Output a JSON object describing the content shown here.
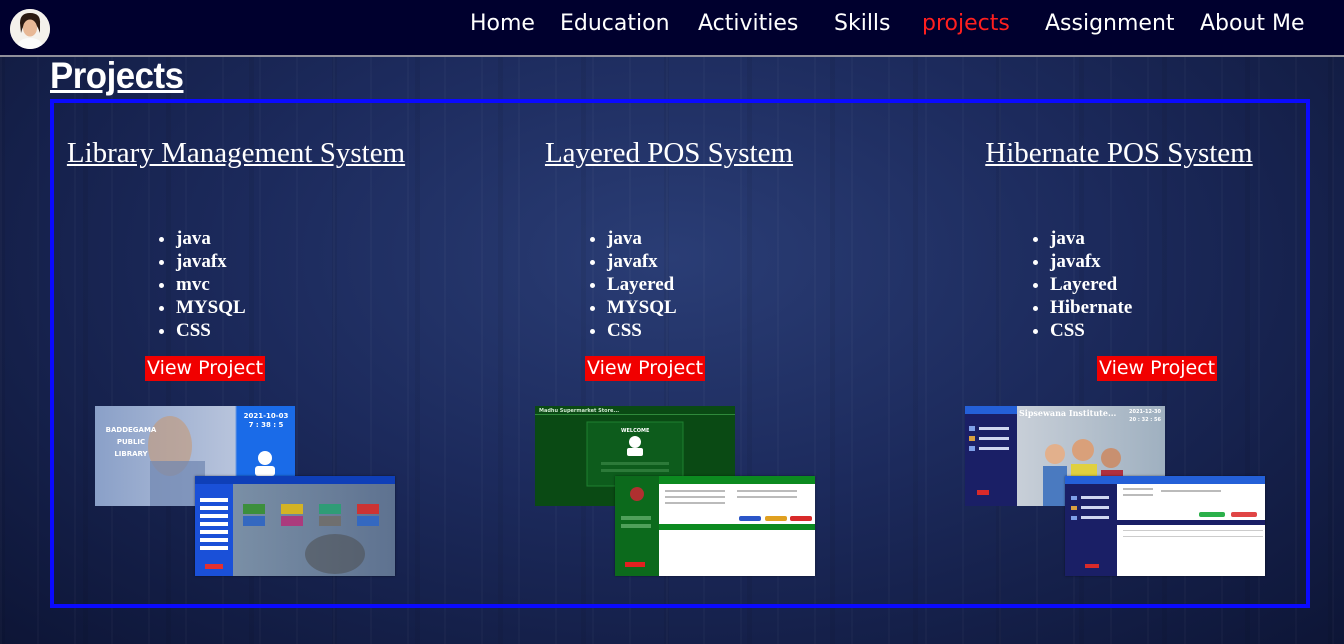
{
  "nav": {
    "items": [
      {
        "label": "Home",
        "active": false
      },
      {
        "label": "Education",
        "active": false
      },
      {
        "label": "Activities",
        "active": false
      },
      {
        "label": "Skills",
        "active": false
      },
      {
        "label": "projects",
        "active": true
      },
      {
        "label": "Assignment",
        "active": false
      },
      {
        "label": "About Me",
        "active": false
      }
    ]
  },
  "page_title": "Projects",
  "colors": {
    "nav_background": "#00002e",
    "active_link": "#ff1f1f",
    "panel_border": "#0a0aff",
    "button_background": "#f10000"
  },
  "projects": [
    {
      "title": "Library Management System",
      "tech": [
        "java",
        "javafx",
        "mvc",
        "MYSQL",
        "CSS"
      ],
      "button_label": "View Project",
      "screens": {
        "back_line1": "BADDEGAMA",
        "back_line2": "PUBLIC",
        "back_line3": "LIBRARY",
        "back_time1": "2021-10-03",
        "back_time2": "7 : 38 : 5"
      }
    },
    {
      "title": "Layered POS System",
      "tech": [
        "java",
        "javafx",
        "Layered",
        "MYSQL",
        "CSS"
      ],
      "button_label": "View Project",
      "screens": {
        "back_header": "Madhu Supermarket Store...",
        "back_welcome": "WELCOME"
      }
    },
    {
      "title": "Hibernate POS System",
      "tech": [
        "java",
        "javafx",
        "Layered",
        "Hibernate",
        "CSS"
      ],
      "button_label": "View Project",
      "screens": {
        "back_header": "Sipsewana Institute...",
        "back_time1": "2021-12-30",
        "back_time2": "20 : 32 : 56"
      }
    }
  ]
}
